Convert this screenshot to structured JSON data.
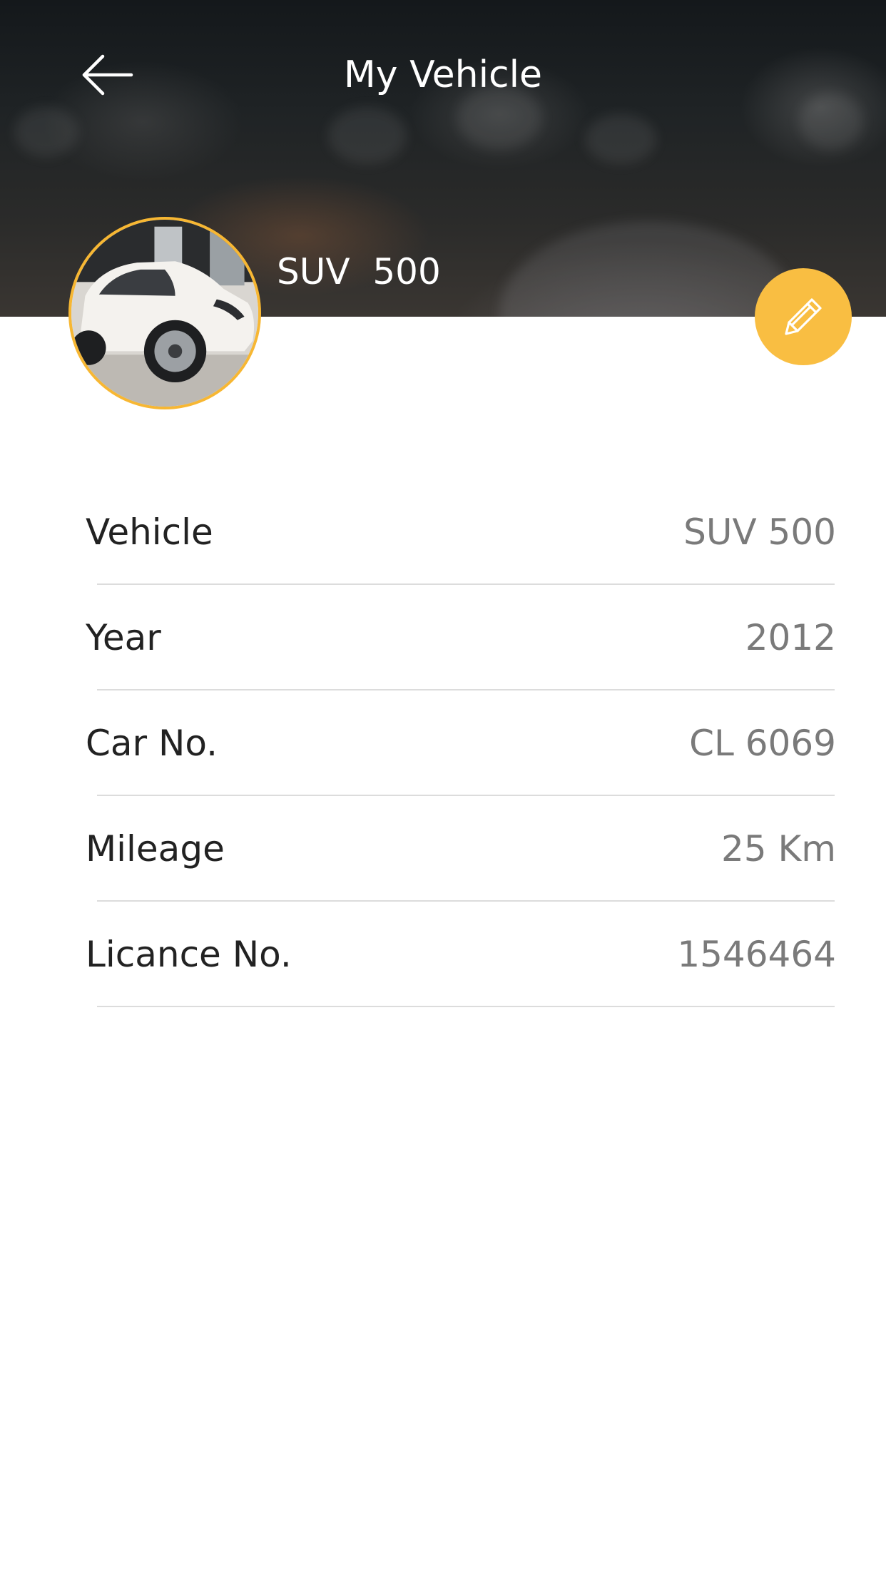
{
  "header": {
    "title": "My Vehicle",
    "back_icon": "arrow-left-icon"
  },
  "profile": {
    "vehicle_name": "SUV  500",
    "avatar": "vehicle-photo",
    "accent_color": "#f9be42",
    "edit_icon": "pencil-icon"
  },
  "details": [
    {
      "label": "Vehicle",
      "value": "SUV 500"
    },
    {
      "label": "Year",
      "value": "2012"
    },
    {
      "label": "Car No.",
      "value": "CL 6069"
    },
    {
      "label": "Mileage",
      "value": "25 Km"
    },
    {
      "label": "Licance No.",
      "value": "1546464"
    }
  ]
}
